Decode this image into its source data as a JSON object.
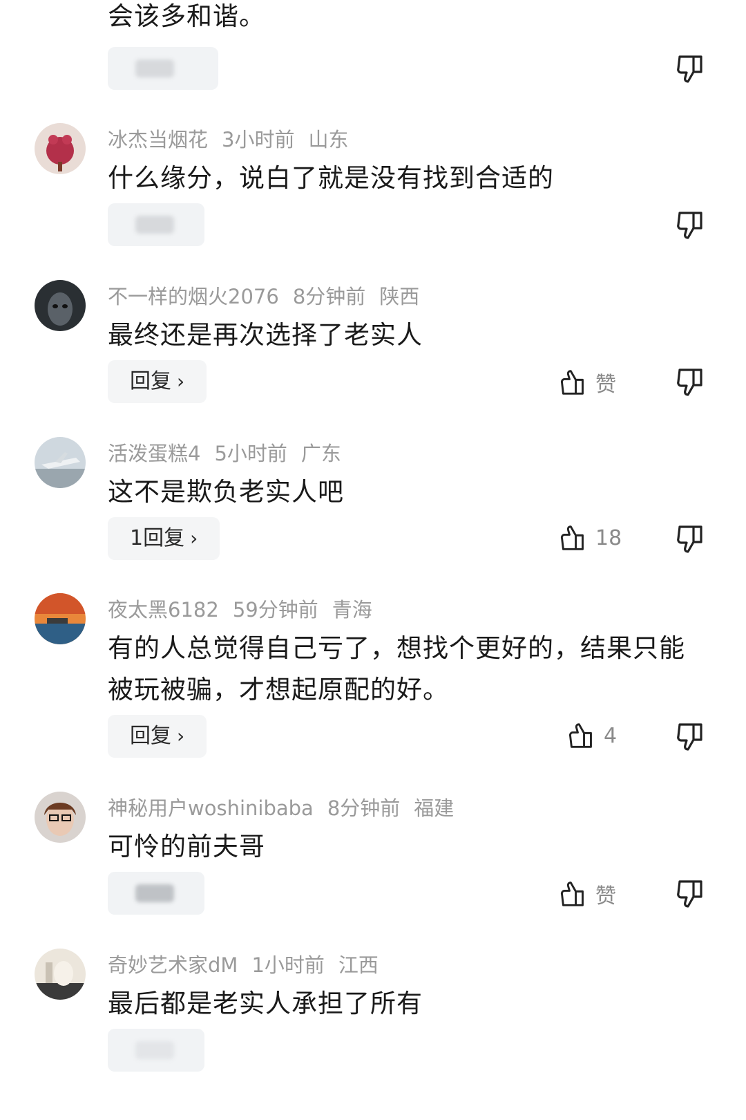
{
  "top_comment": {
    "text": "会该多和谐。"
  },
  "icons": {
    "like": "thumbs-up-icon",
    "dislike": "thumbs-down-icon",
    "chevron": "chevron-right-icon"
  },
  "comments": [
    {
      "username": "冰杰当烟花",
      "time": "3小时前",
      "location": "山东",
      "text": "什么缘分，说白了就是没有找到合适的"
    },
    {
      "username": "不一样的烟火2076",
      "time": "8分钟前",
      "location": "陕西",
      "text": "最终还是再次选择了老实人",
      "reply_label": "回复",
      "like_label": "赞"
    },
    {
      "username": "活泼蛋糕4",
      "time": "5小时前",
      "location": "广东",
      "text": "这不是欺负老实人吧",
      "reply_label": "1回复",
      "like_label": "18"
    },
    {
      "username": "夜太黑6182",
      "time": "59分钟前",
      "location": "青海",
      "text": "有的人总觉得自己亏了，想找个更好的，结果只能被玩被骗，才想起原配的好。",
      "reply_label": "回复",
      "like_label": "4"
    },
    {
      "username": "神秘用户woshinibaba",
      "time": "8分钟前",
      "location": "福建",
      "text": "可怜的前夫哥",
      "like_label": "赞"
    },
    {
      "username": "奇妙艺术家dM",
      "time": "1小时前",
      "location": "江西",
      "text": "最后都是老实人承担了所有"
    }
  ],
  "ui": {
    "chevron_glyph": "›"
  }
}
